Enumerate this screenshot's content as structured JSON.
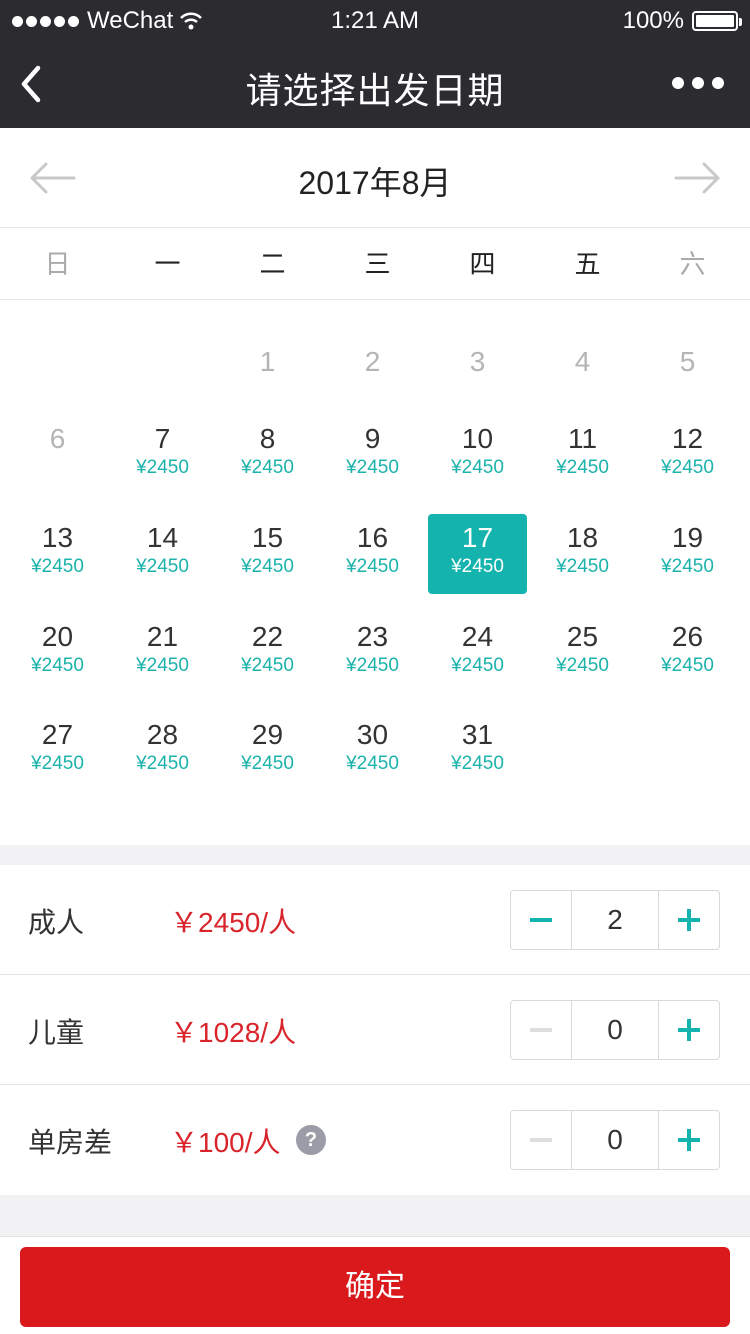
{
  "status_bar": {
    "carrier": "WeChat",
    "time": "1:21 AM",
    "battery": "100%"
  },
  "nav": {
    "title": "请选择出发日期"
  },
  "calendar": {
    "month_title": "2017年8月",
    "weekdays": [
      "日",
      "一",
      "二",
      "三",
      "四",
      "五",
      "六"
    ],
    "weeks": [
      [
        null,
        null,
        {
          "day": "1",
          "price": ""
        },
        {
          "day": "2",
          "price": ""
        },
        {
          "day": "3",
          "price": ""
        },
        {
          "day": "4",
          "price": ""
        },
        {
          "day": "5",
          "price": ""
        }
      ],
      [
        {
          "day": "6",
          "price": ""
        },
        {
          "day": "7",
          "price": "¥2450"
        },
        {
          "day": "8",
          "price": "¥2450"
        },
        {
          "day": "9",
          "price": "¥2450"
        },
        {
          "day": "10",
          "price": "¥2450"
        },
        {
          "day": "11",
          "price": "¥2450"
        },
        {
          "day": "12",
          "price": "¥2450"
        }
      ],
      [
        {
          "day": "13",
          "price": "¥2450"
        },
        {
          "day": "14",
          "price": "¥2450"
        },
        {
          "day": "15",
          "price": "¥2450"
        },
        {
          "day": "16",
          "price": "¥2450"
        },
        {
          "day": "17",
          "price": "¥2450",
          "selected": true
        },
        {
          "day": "18",
          "price": "¥2450"
        },
        {
          "day": "19",
          "price": "¥2450"
        }
      ],
      [
        {
          "day": "20",
          "price": "¥2450"
        },
        {
          "day": "21",
          "price": "¥2450"
        },
        {
          "day": "22",
          "price": "¥2450"
        },
        {
          "day": "23",
          "price": "¥2450"
        },
        {
          "day": "24",
          "price": "¥2450"
        },
        {
          "day": "25",
          "price": "¥2450"
        },
        {
          "day": "26",
          "price": "¥2450"
        }
      ],
      [
        {
          "day": "27",
          "price": "¥2450"
        },
        {
          "day": "28",
          "price": "¥2450"
        },
        {
          "day": "29",
          "price": "¥2450"
        },
        {
          "day": "30",
          "price": "¥2450"
        },
        {
          "day": "31",
          "price": "¥2450"
        },
        null,
        null
      ]
    ]
  },
  "options": {
    "adult": {
      "label": "成人",
      "price": "￥2450/人",
      "count": "2"
    },
    "child": {
      "label": "儿童",
      "price": "￥1028/人",
      "count": "0"
    },
    "single_room": {
      "label": "单房差",
      "price": "￥100/人",
      "count": "0",
      "help": "?"
    }
  },
  "footer": {
    "confirm_label": "确定"
  },
  "colors": {
    "accent": "#14b3ad",
    "price_red": "#d8242a",
    "confirm_red": "#d9191c",
    "header_dark": "#2b2b30"
  }
}
